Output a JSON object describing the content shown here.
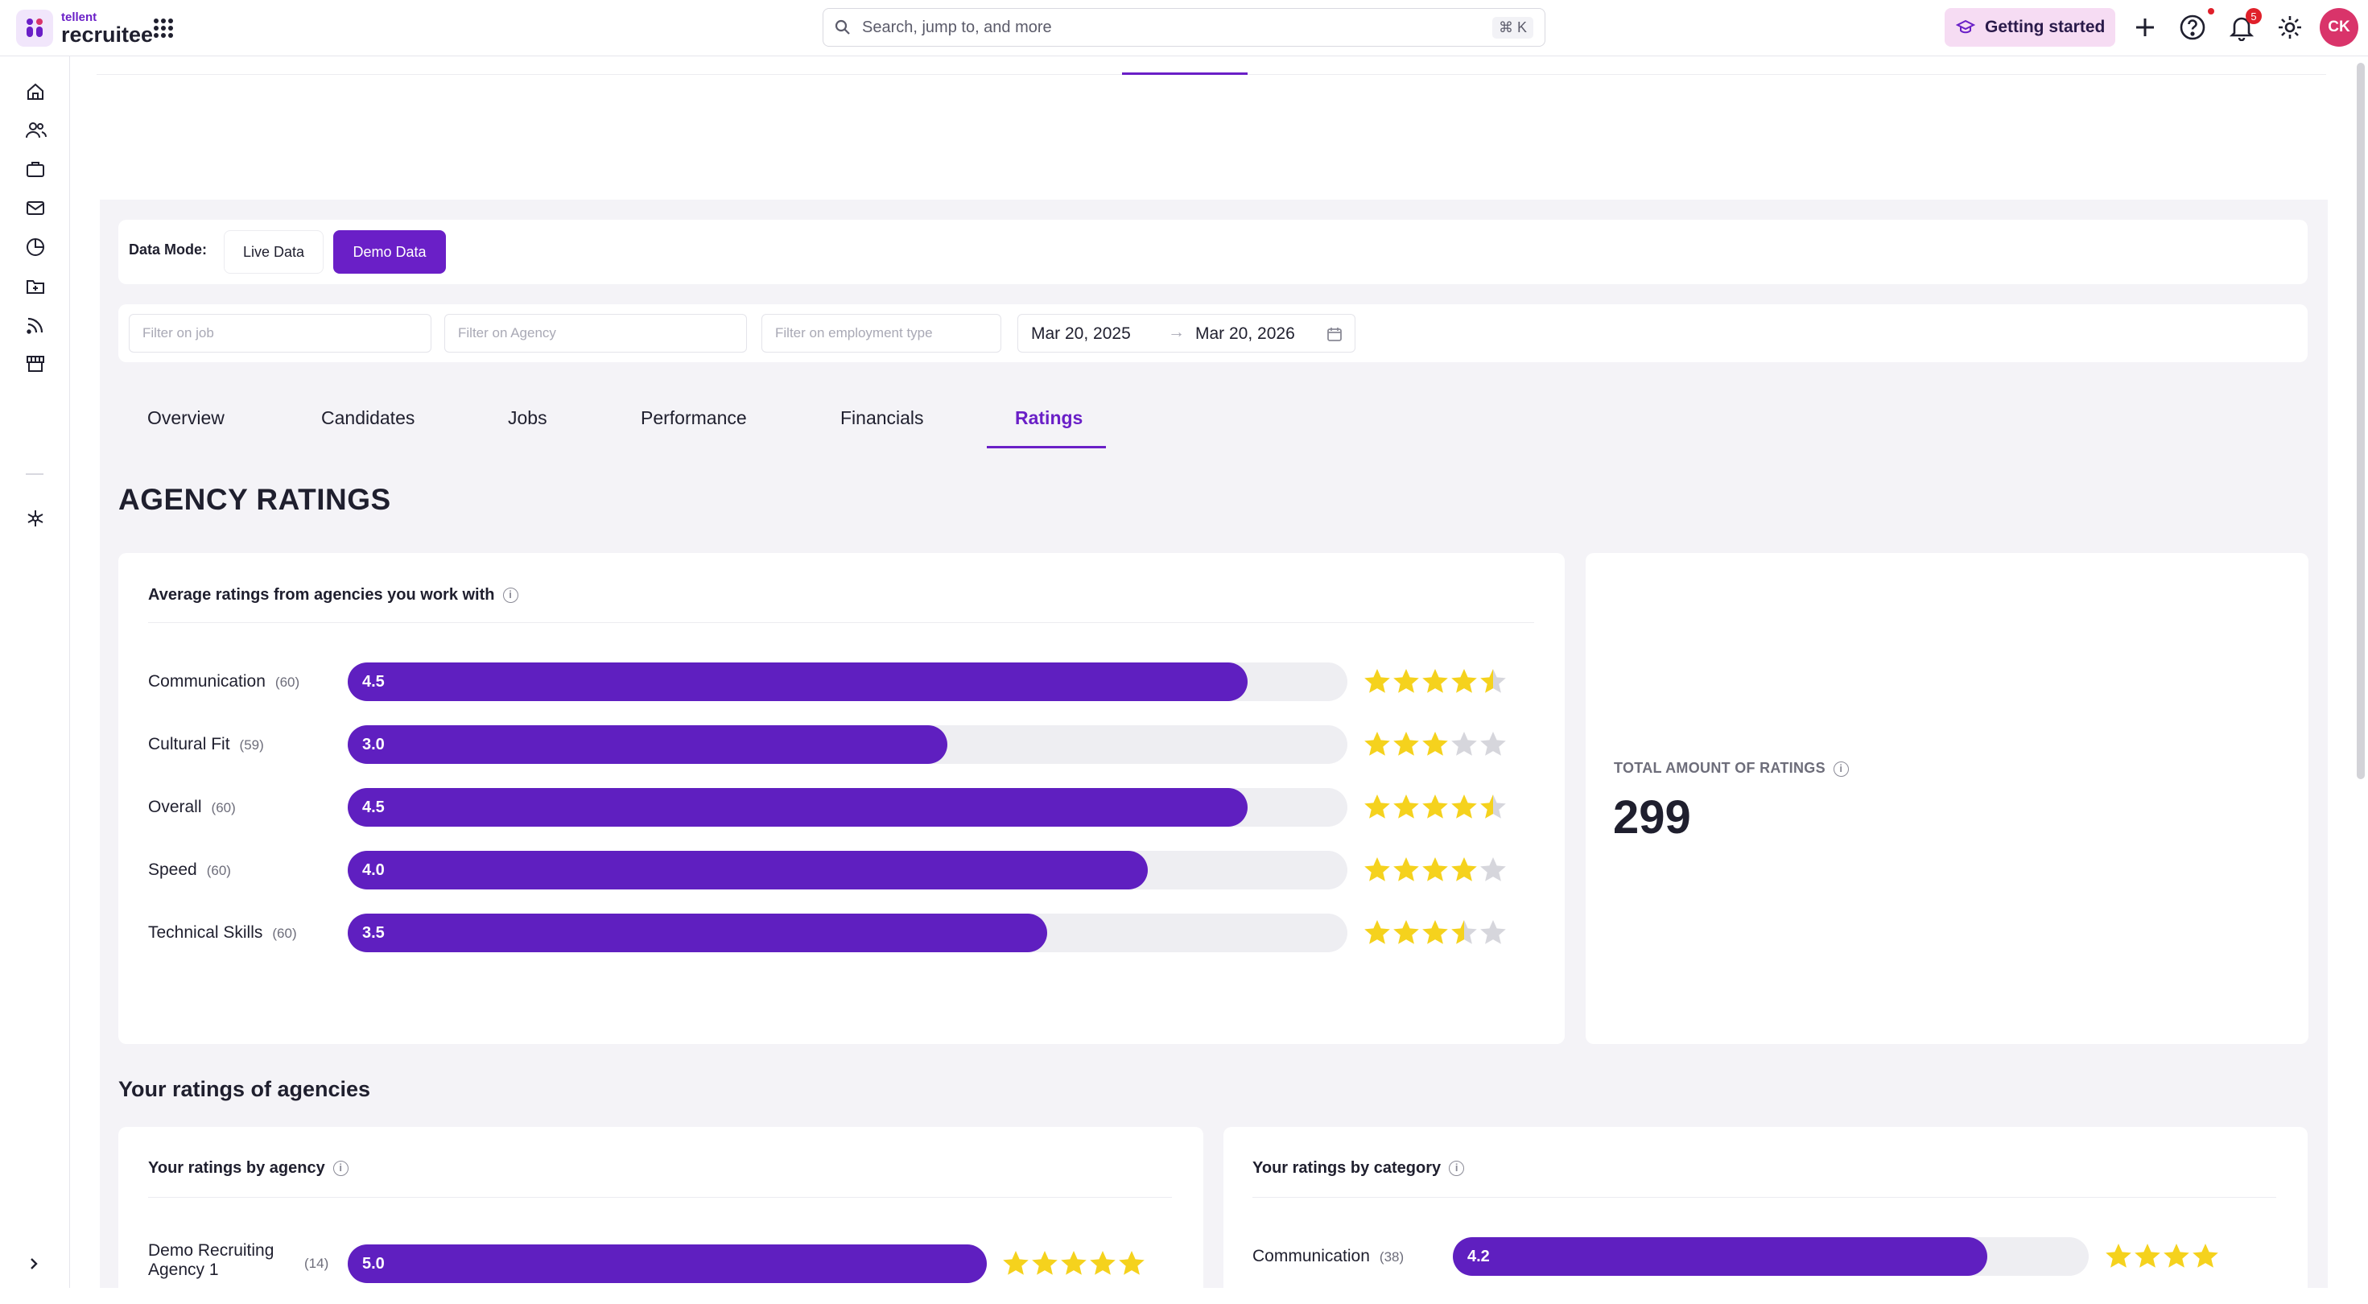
{
  "app": {
    "brand_small": "tellent",
    "brand_big": "recruitee"
  },
  "search": {
    "placeholder": "Search, jump to, and more",
    "shortcut": "⌘ K"
  },
  "topbar": {
    "getting_started": "Getting started",
    "notifications_count": "5",
    "avatar_initials": "CK"
  },
  "data_mode": {
    "label": "Data Mode:",
    "live": "Live Data",
    "demo": "Demo Data",
    "selected": "Demo Data"
  },
  "filters": {
    "job_placeholder": "Filter on job",
    "agency_placeholder": "Filter on Agency",
    "employment_placeholder": "Filter on employment type",
    "date_from": "Mar 20, 2025",
    "date_to": "Mar 20, 2026"
  },
  "tabs": [
    {
      "label": "Overview",
      "active": false
    },
    {
      "label": "Candidates",
      "active": false
    },
    {
      "label": "Jobs",
      "active": false
    },
    {
      "label": "Performance",
      "active": false
    },
    {
      "label": "Financials",
      "active": false
    },
    {
      "label": "Ratings",
      "active": true
    }
  ],
  "page_title": "AGENCY RATINGS",
  "avg_card": {
    "title": "Average ratings from agencies you work with",
    "max": 5,
    "rows": [
      {
        "label": "Communication",
        "count": "(60)",
        "value": "4.5"
      },
      {
        "label": "Cultural Fit",
        "count": "(59)",
        "value": "3.0"
      },
      {
        "label": "Overall",
        "count": "(60)",
        "value": "4.5"
      },
      {
        "label": "Speed",
        "count": "(60)",
        "value": "4.0"
      },
      {
        "label": "Technical Skills",
        "count": "(60)",
        "value": "3.5"
      }
    ]
  },
  "total_card": {
    "label": "TOTAL AMOUNT OF RATINGS",
    "value": "299"
  },
  "section2_title": "Your ratings of agencies",
  "by_agency": {
    "title": "Your ratings by agency",
    "rows": [
      {
        "label": "Demo Recruiting Agency 1",
        "count": "(14)",
        "value": "5.0"
      }
    ]
  },
  "by_category": {
    "title": "Your ratings by category",
    "rows": [
      {
        "label": "Communication",
        "count": "(38)",
        "value": "4.2"
      }
    ]
  },
  "colors": {
    "accent": "#6a1fc7",
    "bar": "#5f1fc0",
    "star": "#f5d21d",
    "star_empty": "#d6d6dc",
    "track": "#eeeef2"
  }
}
